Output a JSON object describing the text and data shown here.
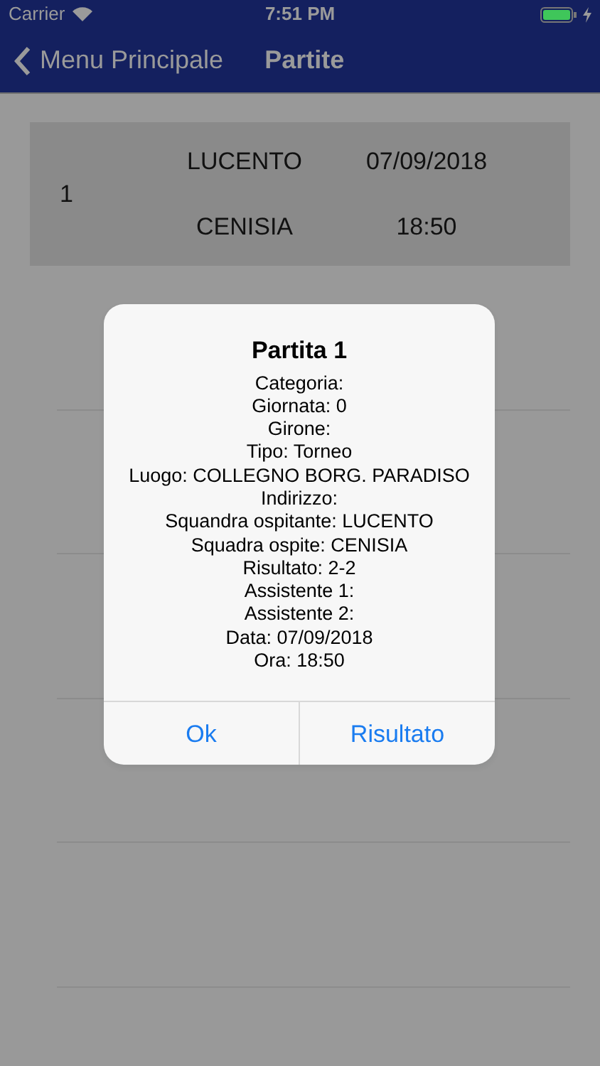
{
  "status_bar": {
    "carrier": "Carrier",
    "time": "7:51 PM"
  },
  "nav_bar": {
    "back_label": "Menu Principale",
    "title": "Partite"
  },
  "matches": [
    {
      "number": "1",
      "home_team": "LUCENTO",
      "away_team": "CENISIA",
      "date": "07/09/2018",
      "time": "18:50"
    }
  ],
  "alert": {
    "title": "Partita 1",
    "lines": [
      "Categoria:",
      "Giornata: 0",
      "Girone:",
      "Tipo: Torneo",
      "Luogo: COLLEGNO BORG. PARADISO",
      "Indirizzo:",
      "Squandra ospitante: LUCENTO",
      "Squadra ospite: CENISIA",
      "Risultato: 2-2",
      "Assistente 1:",
      "Assistente 2:",
      "Data: 07/09/2018",
      "Ora: 18:50"
    ],
    "buttons": [
      "Ok",
      "Risultato"
    ]
  }
}
